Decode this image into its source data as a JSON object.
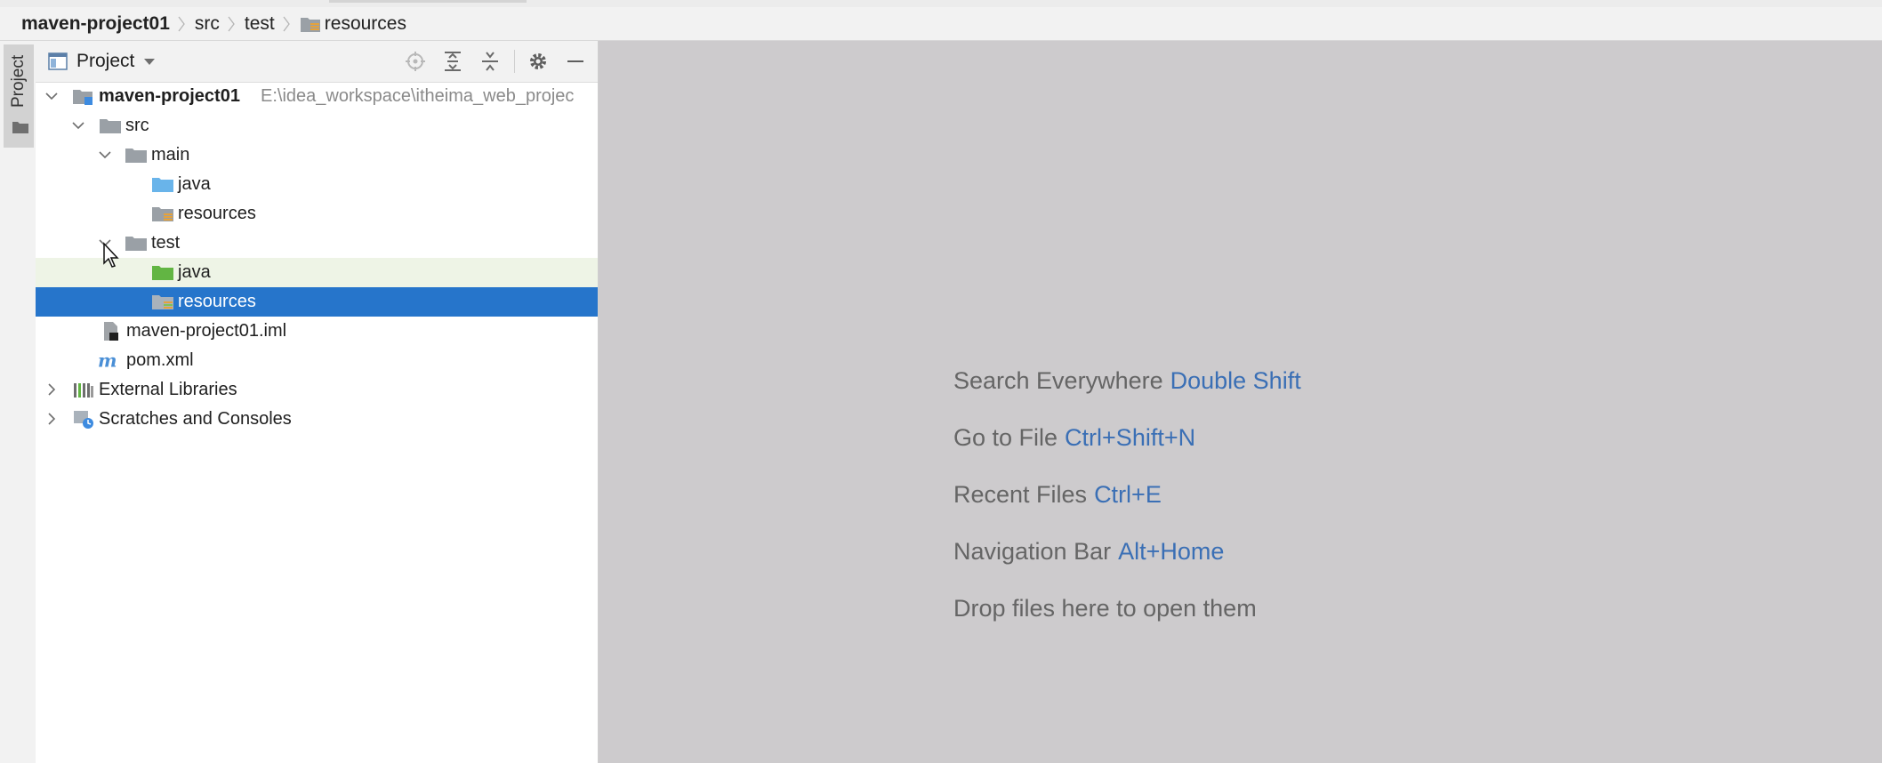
{
  "breadcrumb": {
    "items": [
      {
        "label": "maven-project01",
        "bold": true
      },
      {
        "label": "src"
      },
      {
        "label": "test"
      },
      {
        "label": "resources",
        "icon": "resources-folder-icon"
      }
    ]
  },
  "tool_strip": {
    "project_label": "Project"
  },
  "project_panel": {
    "title": "Project",
    "header_icons": [
      "locate-icon",
      "expand-all-icon",
      "collapse-all-icon",
      "gear-icon",
      "minimize-icon"
    ],
    "tree": [
      {
        "label": "maven-project01",
        "bold": true,
        "path": "E:\\idea_workspace\\itheima_web_projec",
        "level": 0,
        "expanded": true,
        "icon": "module-folder-icon"
      },
      {
        "label": "src",
        "level": 1,
        "expanded": true,
        "icon": "folder-icon"
      },
      {
        "label": "main",
        "level": 2,
        "expanded": true,
        "icon": "folder-icon"
      },
      {
        "label": "java",
        "level": 3,
        "icon": "source-folder-icon"
      },
      {
        "label": "resources",
        "level": 3,
        "icon": "resources-folder-icon"
      },
      {
        "label": "test",
        "level": 2,
        "expanded": true,
        "icon": "folder-icon"
      },
      {
        "label": "java",
        "level": 3,
        "icon": "test-source-folder-icon",
        "state": "hover"
      },
      {
        "label": "resources",
        "level": 3,
        "icon": "test-resources-folder-icon",
        "state": "selected"
      },
      {
        "label": "maven-project01.iml",
        "level": 1,
        "icon": "iml-file-icon"
      },
      {
        "label": "pom.xml",
        "level": 1,
        "icon": "maven-icon"
      },
      {
        "label": "External Libraries",
        "level": 0,
        "expanded": false,
        "icon": "libraries-icon"
      },
      {
        "label": "Scratches and Consoles",
        "level": 0,
        "expanded": false,
        "icon": "scratches-icon"
      }
    ]
  },
  "editor": {
    "hints": [
      {
        "text": "Search Everywhere",
        "key": "Double Shift"
      },
      {
        "text": "Go to File",
        "key": "Ctrl+Shift+N"
      },
      {
        "text": "Recent Files",
        "key": "Ctrl+E"
      },
      {
        "text": "Navigation Bar",
        "key": "Alt+Home"
      },
      {
        "text": "Drop files here to open them",
        "key": ""
      }
    ]
  },
  "colors": {
    "selection": "#2675cb",
    "hover": "#eef4e6",
    "editor_bg": "#cdcbcd",
    "hint_text": "#656565",
    "hint_key": "#3a6fb5"
  }
}
